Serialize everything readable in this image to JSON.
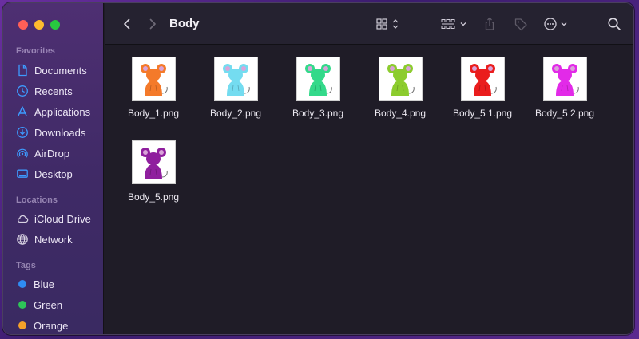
{
  "window": {
    "title": "Body"
  },
  "sidebar": {
    "favorites_label": "Favorites",
    "favorites": [
      {
        "label": "Documents",
        "icon": "document-icon"
      },
      {
        "label": "Recents",
        "icon": "clock-icon"
      },
      {
        "label": "Applications",
        "icon": "applications-icon"
      },
      {
        "label": "Downloads",
        "icon": "download-icon"
      },
      {
        "label": "AirDrop",
        "icon": "airdrop-icon"
      },
      {
        "label": "Desktop",
        "icon": "desktop-icon"
      }
    ],
    "locations_label": "Locations",
    "locations": [
      {
        "label": "iCloud Drive",
        "icon": "cloud-icon"
      },
      {
        "label": "Network",
        "icon": "globe-icon"
      }
    ],
    "tags_label": "Tags",
    "tags": [
      {
        "label": "Blue",
        "color": "#2f8cf4"
      },
      {
        "label": "Green",
        "color": "#2ec458"
      },
      {
        "label": "Orange",
        "color": "#f4a12a"
      }
    ]
  },
  "toolbar": {
    "icons": [
      "back-icon",
      "forward-icon",
      "grid-view-icon",
      "group-icon",
      "share-icon",
      "tag-icon",
      "more-icon",
      "search-icon"
    ]
  },
  "files": [
    {
      "name": "Body_1.png",
      "color": "#f47a2a"
    },
    {
      "name": "Body_2.png",
      "color": "#74dcf0"
    },
    {
      "name": "Body_3.png",
      "color": "#33d98a"
    },
    {
      "name": "Body_4.png",
      "color": "#8ccc2e"
    },
    {
      "name": "Body_5 1.png",
      "color": "#ea1d1d"
    },
    {
      "name": "Body_5 2.png",
      "color": "#e22ae8"
    },
    {
      "name": "Body_5.png",
      "color": "#8f1f9e"
    }
  ]
}
